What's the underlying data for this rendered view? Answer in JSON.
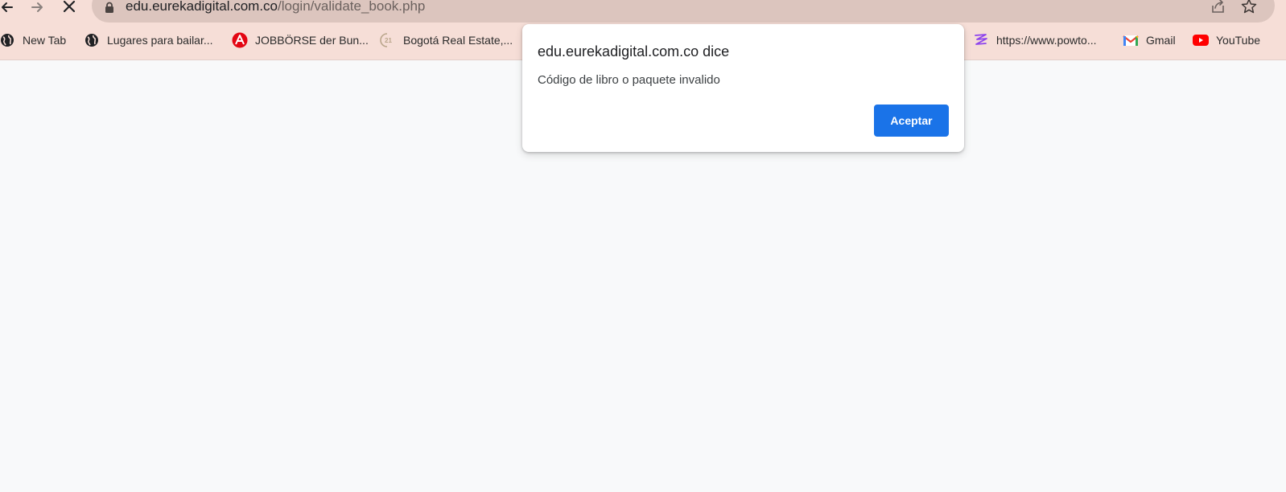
{
  "browser": {
    "url_host": "edu.eurekadigital.com.co",
    "url_path": "/login/validate_book.php"
  },
  "bookmarks": [
    {
      "label": "New Tab",
      "icon": "globe-icon"
    },
    {
      "label": "Lugares para bailar...",
      "icon": "globe-icon"
    },
    {
      "label": "JOBBÖRSE der Bun...",
      "icon": "arbeitsagentur-icon"
    },
    {
      "label": "Bogotá Real Estate,...",
      "icon": "century21-icon"
    },
    {
      "label": "https://www.powto...",
      "icon": "powtoon-icon"
    },
    {
      "label": "Gmail",
      "icon": "gmail-icon"
    },
    {
      "label": "YouTube",
      "icon": "youtube-icon"
    }
  ],
  "dialog": {
    "title": "edu.eurekadigital.com.co dice",
    "message": "Código de libro o paquete invalido",
    "ok_label": "Aceptar"
  },
  "colors": {
    "toolbar_bg": "#f6ded7",
    "omnibox_bg": "#dcc5be",
    "page_bg": "#f8f9fa",
    "accent": "#1a73e8"
  }
}
